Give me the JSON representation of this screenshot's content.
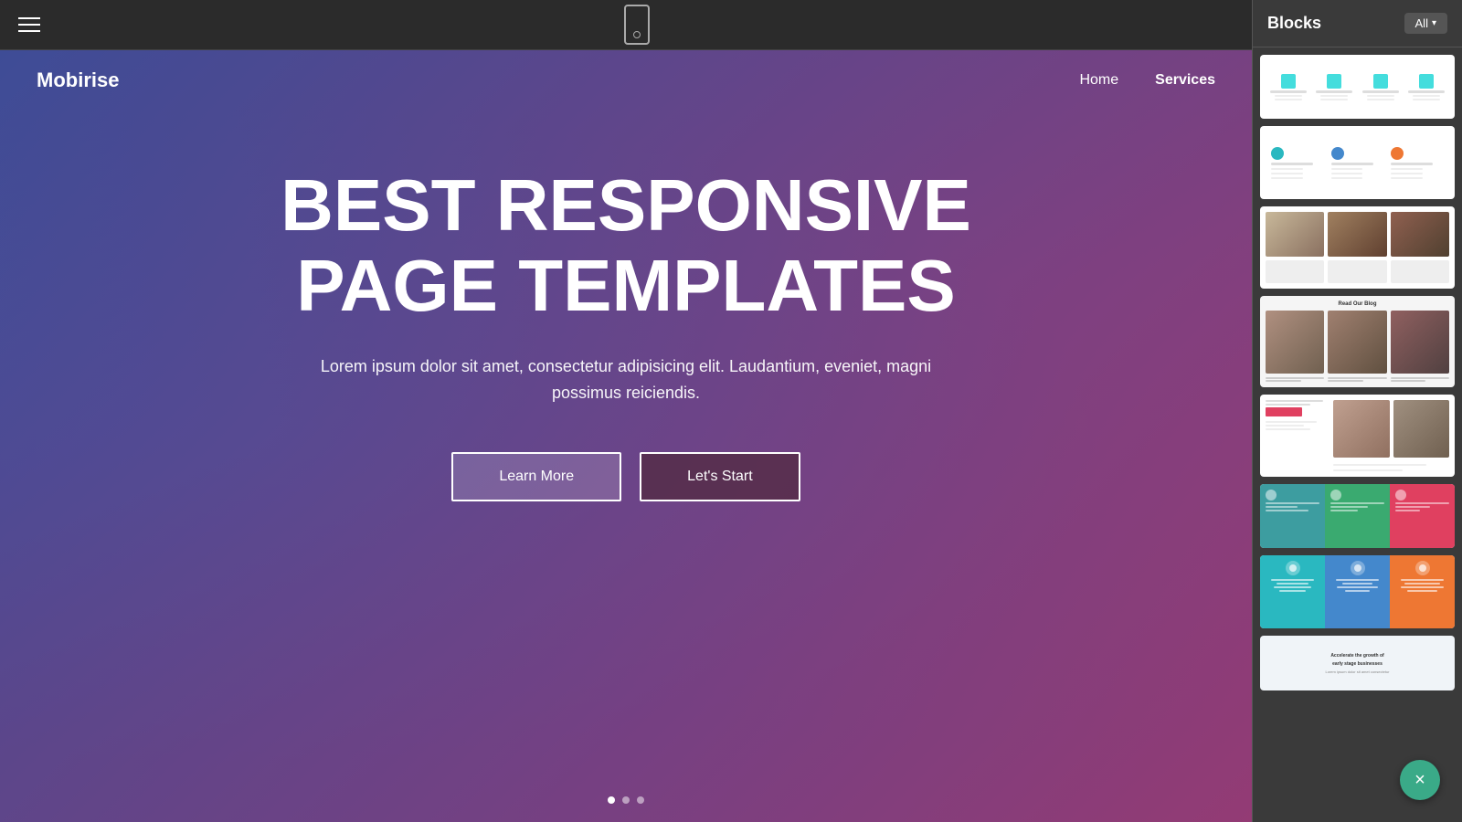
{
  "toolbar": {
    "device_label": "Mobile preview"
  },
  "hero": {
    "brand": "Mobirise",
    "nav_home": "Home",
    "nav_services": "Services",
    "title_line1": "BEST RESPONSIVE",
    "title_line2": "PAGE TEMPLATES",
    "subtitle": "Lorem ipsum dolor sit amet, consectetur adipisicing elit. Laudantium, eveniet, magni possimus reiciendis.",
    "btn_learn": "Learn More",
    "btn_start": "Let's Start"
  },
  "panel": {
    "title": "Blocks",
    "filter_all": "All",
    "blocks": [
      {
        "id": 1,
        "type": "features-icons"
      },
      {
        "id": 2,
        "type": "features-colored-icons"
      },
      {
        "id": 3,
        "type": "photo-grid"
      },
      {
        "id": 4,
        "type": "blog-grid"
      },
      {
        "id": 5,
        "type": "conference-news"
      },
      {
        "id": 6,
        "type": "colored-features-3col"
      },
      {
        "id": 7,
        "type": "colored-3col-icons"
      },
      {
        "id": 8,
        "type": "landing-hero"
      }
    ],
    "read_our_blog": "Read Our Blog"
  },
  "fab": {
    "close_label": "×"
  }
}
